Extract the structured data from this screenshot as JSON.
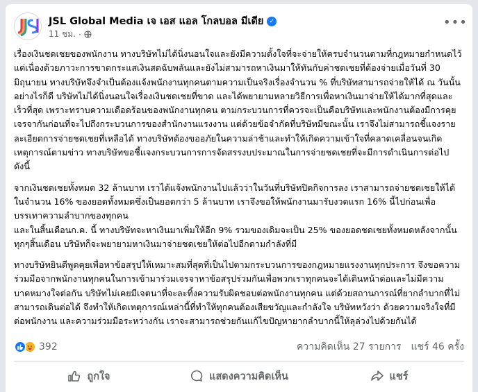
{
  "page": {
    "name": "JSL Global Media เจ เอส แอล โกลบอล มีเดีย",
    "time": "11 ชม.",
    "more_icon": "ellipsis-icon",
    "privacy_icon": "globe-icon",
    "verified_icon": "verified-badge-icon"
  },
  "post": {
    "paragraphs": [
      "เรื่องเงินชดเชยของพนักงาน ทางบริษัทไม่ได้นิ่งนอนใจและยังมีความตั้งใจที่จะจ่ายให้ครบจำนวนตามที่กฎหมายกำหนดไว้ แต่เนื่องด้วยภาวะการขาดกระแสเงินสดฉับพลันและยังไม่สามารถหาเงินมาให้ทันกับค่าชดเชยที่ต้องจ่ายเมื่อวันที่ 30 มิถุนายน ทางบริษัทจึงจำเป็นต้องแจ้งพนักงานทุกคนตามความเป็นจริงเรื่องจำนวน % ที่บริษัทสามารถจ่ายให้ได้ ณ วันนั้น อย่างไรก็ดี บริษัทไม่ได้นิ่งนอนใจเรื่องเงินชดเชยที่ขาด และได้พยายามหลายวิธีการเพื่อหาเงินมาจ่ายให้ได้มากที่สุดและเร็วที่สุด เพราะทราบความเดือดร้อนของพนักงานทุกคน ตามกระบวนการที่ควรจะเป็นคือบริษัทและพนักงานต้องมีการคุยเจรจากันก่อนที่จะไปถึงกระบวนการของสำนักงานแรงงาน แต่ด้วยข้อจำกัดที่บริษัทมีขณะนั้น เราจึงไม่สามารถชี้แจงรายละเอียดการจ่ายชดเชยที่เหลือได้ ทางบริษัทต้องขออภัยในความล่าช้าและทำให้เกิดความเข้าใจที่คลาดเคลื่อนจนเกิดเหตุการณ์ตามข่าว ทางบริษัทขอชี้แจงกระบวนการการจัดสรรงบประมาณในการจ่ายชดเชยที่จะมีการดำเนินการต่อไปดังนี้",
      "จากเงินชดเชยทั้งหมด 32 ล้านบาท เราได้แจ้งพนักงานไปแล้วว่าในวันที่บริษัทปิดกิจการลง เราสามารถจ่ายชดเชยให้ได้ในจำนวน 16% ของยอดทั้งหมดซึ่งเป็นยอดกว่า 5 ล้านบาท เราจึงขอให้พนักงานมารับงวดแรก 16% นี้ไปก่อนเพื่อบรรเทาความลำบากของทุกคน\nและในสิ้นเดือนก.ค. นี้ ทางบริษัทจะหาเงินมาเพิ่มให้อีก 9% รวมของเดิมจะเป็น 25% ของยอดชดเชยทั้งหมดหลังจากนั้น ทุกๆสิ้นเดือน บริษัทก็จะพยายามหาเงินมาจ่ายชดเชยให้ต่อไปอีกตามกำลังที่มี",
      "ทางบริษัทยินดีพูดคุยเพื่อหาข้อสรุปให้เหมาะสมที่สุดที่เป็นไปตามกระบวนการของกฎหมายแรงงานทุกประการ จึงขอความร่วมมือจากพนักงานทุกคนในการเข้ามาร่วมเจรจาหาข้อสรุปร่วมกันเพื่อพวกเราทุกคนจะได้เดินหน้าต่อและไม่มีความบาดหมางใจต่อกัน บริษัทไม่เคยมีเจตนาที่จะละทิ้งความรับผิดชอบต่อพนักงานทุกคน แต่ด้วยสถานการณ์ที่ยากลำบากที่ไม่สามารถเดินต่อได้ จึงทำให้เกิดเหตุการณ์เหล่านี้ที่ทำให้ทุกคนต้องเสียขวัญและกำลังใจ บริษัทหวังว่า ด้วยความจริงใจที่มีต่อพนักงาน และความร่วมมือระหว่างกัน เราจะสามารถช่วยกันแก้ไขปัญหายากลำบากนี้ให้ลุล่วงไปด้วยกันได้"
    ]
  },
  "stats": {
    "reaction_count": "392",
    "comments": "ความคิดเห็น 27 รายการ",
    "shares": "แชร์ 46 ครั้ง",
    "reaction_icons": [
      "like-reaction-icon",
      "care-reaction-icon"
    ]
  },
  "actions": {
    "like_label": "ถูกใจ",
    "comment_label": "แสดงความคิดเห็น",
    "share_label": "แชร์"
  },
  "colors": {
    "accent": "#1877f2",
    "secondary_text": "#65676b",
    "background": "#e4e6eb"
  }
}
